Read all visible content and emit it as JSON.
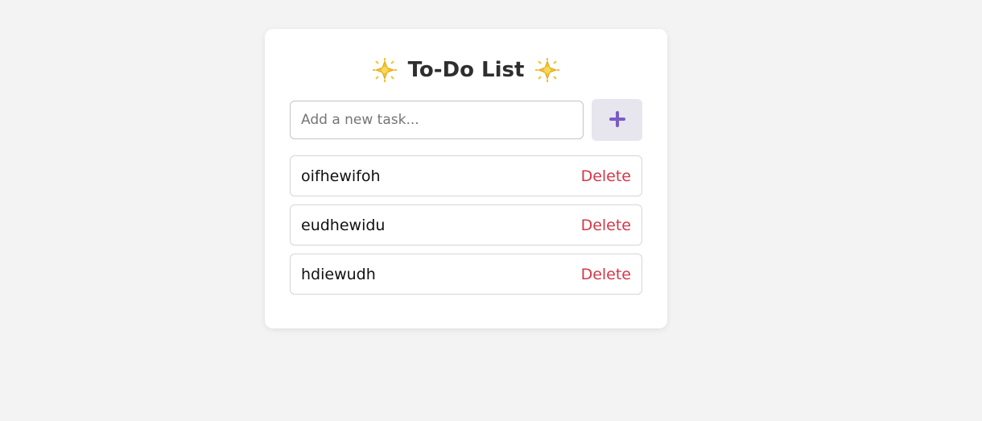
{
  "app": {
    "title": "To-Do List",
    "title_icon_left": "sparkle-star-icon",
    "title_icon_right": "sparkle-star-icon"
  },
  "new_task": {
    "value": "",
    "placeholder": "Add a new task...",
    "add_icon": "plus-icon"
  },
  "tasks": [
    {
      "text": "oifhewifoh",
      "delete_label": "Delete"
    },
    {
      "text": "eudhewidu",
      "delete_label": "Delete"
    },
    {
      "text": "hdiewudh",
      "delete_label": "Delete"
    }
  ],
  "colors": {
    "accent": "#7a5cc4",
    "delete": "#d2384a",
    "add_button_bg": "#e7e5ee",
    "star": "#f2c230"
  }
}
